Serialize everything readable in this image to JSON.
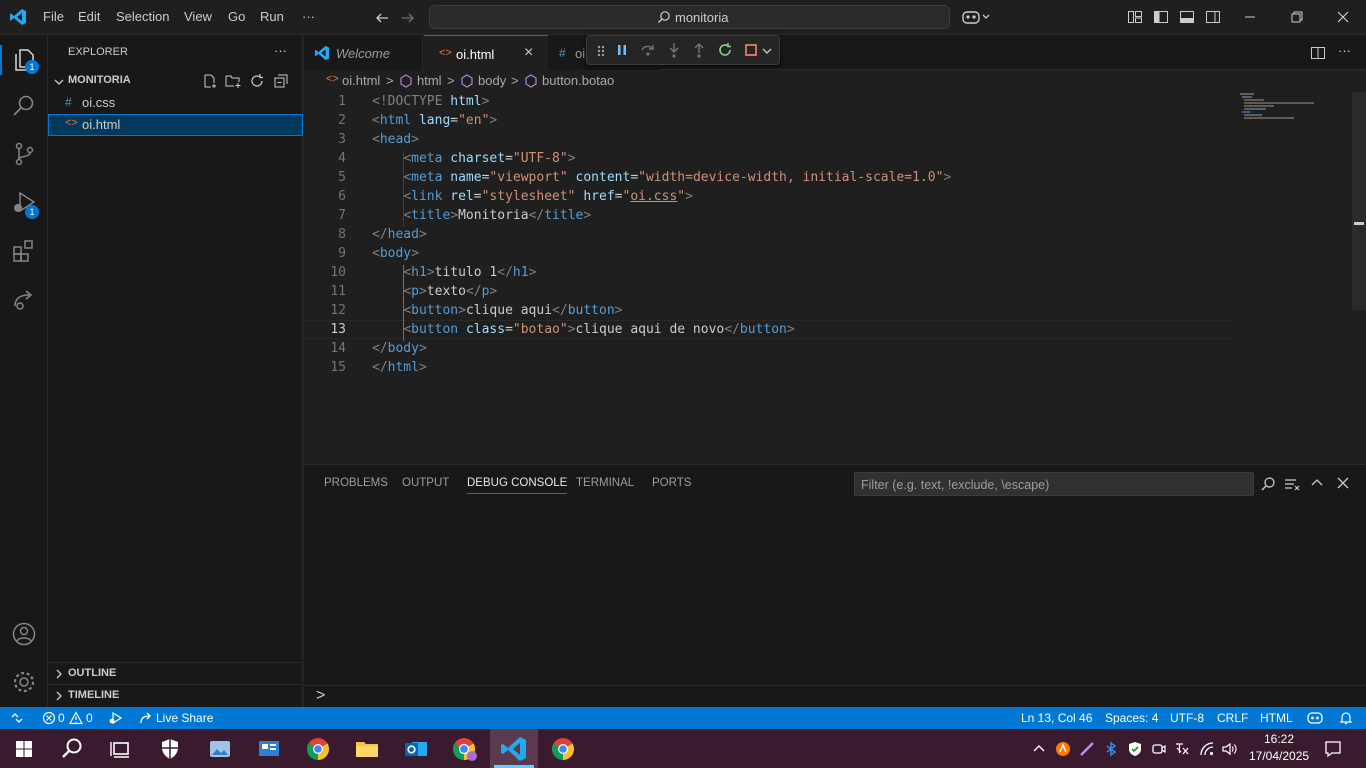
{
  "menu": {
    "file": "File",
    "edit": "Edit",
    "selection": "Selection",
    "view": "View",
    "go": "Go",
    "run": "Run",
    "more": "···"
  },
  "search": {
    "text": "monitoria"
  },
  "activity": {
    "explorer_badge": "1",
    "debug_badge": "1"
  },
  "sidebar": {
    "title": "EXPLORER",
    "more": "···",
    "folder": "MONITORIA",
    "files": [
      {
        "icon": "#",
        "name": "oi.css"
      },
      {
        "icon": "<>",
        "name": "oi.html"
      }
    ],
    "outline": "OUTLINE",
    "timeline": "TIMELINE"
  },
  "tabs": [
    {
      "label": "Welcome"
    },
    {
      "label": "oi.html",
      "close": "×"
    },
    {
      "label": "oi"
    }
  ],
  "breadcrumb": {
    "file": "oi.html",
    "sep": ">",
    "b1": "html",
    "b2": "body",
    "b3": "button.botao"
  },
  "code": {
    "line_numbers": [
      "1",
      "2",
      "3",
      "4",
      "5",
      "6",
      "7",
      "8",
      "9",
      "10",
      "11",
      "12",
      "13",
      "14",
      "15"
    ],
    "l1": {
      "a": "<!DOCTYPE",
      "b": "html",
      ">": ">"
    },
    "l2": {
      "o": "<",
      "tag": "html",
      "attr": "lang",
      "eq": "=",
      "val": "\"en\"",
      "c": ">"
    },
    "l3": {
      "o": "<",
      "tag": "head",
      "c": ">"
    },
    "l4": {
      "o": "<",
      "tag": "meta",
      "attr": "charset",
      "eq": "=",
      "val": "\"UTF-8\"",
      "c": ">"
    },
    "l5": {
      "o": "<",
      "tag": "meta",
      "attr1": "name",
      "eq": "=",
      "val1": "\"viewport\"",
      "attr2": "content",
      "val2": "\"width=device-width, initial-scale=1.0\"",
      "c": ">"
    },
    "l6": {
      "o": "<",
      "tag": "link",
      "attr1": "rel",
      "eq": "=",
      "val1": "\"stylesheet\"",
      "attr2": "href",
      "q": "\"",
      "link": "oi.css",
      "c": ">"
    },
    "l7": {
      "o": "<",
      "tag": "title",
      "c": ">",
      "text": "Monitoria",
      "o2": "</",
      "c2": ">"
    },
    "l8": {
      "o": "</",
      "tag": "head",
      "c": ">"
    },
    "l9": {
      "o": "<",
      "tag": "body",
      "c": ">"
    },
    "l10": {
      "o": "<",
      "tag": "h1",
      "c": ">",
      "text": "titulo 1",
      "o2": "</"
    },
    "l11": {
      "o": "<",
      "tag": "p",
      "c": ">",
      "text": "texto",
      "o2": "</"
    },
    "l12": {
      "o": "<",
      "tag": "button",
      "c": ">",
      "text": "clique aqui",
      "o2": "</"
    },
    "l13": {
      "o": "<",
      "tag": "button",
      "attr": "class",
      "eq": "=",
      "val": "\"botao\"",
      "c": ">",
      "text": "clique aqui de novo",
      "o2": "</"
    },
    "l14": {
      "o": "</",
      "tag": "body",
      "c": ">"
    },
    "l15": {
      "o": "</",
      "tag": "html",
      "c": ">"
    }
  },
  "panel": {
    "tabs": [
      "PROBLEMS",
      "OUTPUT",
      "DEBUG CONSOLE",
      "TERMINAL",
      "PORTS"
    ],
    "filter_placeholder": "Filter (e.g. text, !exclude, \\escape)",
    "prompt": ">"
  },
  "status": {
    "errors": "0",
    "warnings": "0",
    "live_share": "Live Share",
    "position": "Ln 13, Col 46",
    "spaces": "Spaces: 4",
    "encoding": "UTF-8",
    "eol": "CRLF",
    "language": "HTML"
  },
  "taskbar": {
    "time": "16:22",
    "date": "17/04/2025"
  },
  "colors": {
    "accent": "#0078d4",
    "tag": "#569cd6",
    "attribute": "#9cdcfe",
    "string": "#ce9178",
    "taskbar": "#3a1b2e"
  }
}
